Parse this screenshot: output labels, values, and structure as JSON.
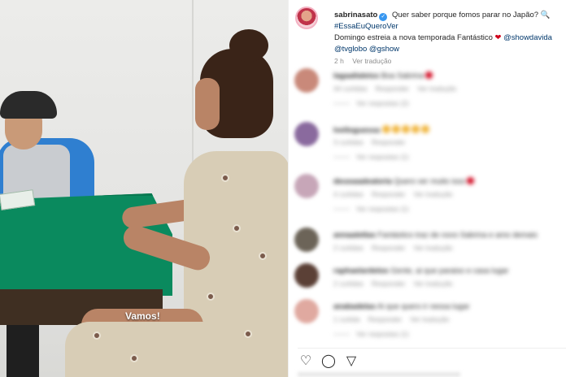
{
  "video": {
    "caption": "Vamos!"
  },
  "post": {
    "username": "sabrinasato",
    "verified_symbol": "✓",
    "text_part1": "Quer saber porque fomos parar no Japão?",
    "text_emoji": "🔍",
    "hashtag": "#EssaEuQueroVer",
    "text_line3": "Domingo estreia a nova temporada Fantástico",
    "heart_symbol": "❤",
    "mention_show": "@showdavida",
    "mention_tvglobo": "@tvglobo",
    "mention_gshow": "@gshow",
    "time": "2 h",
    "translate": "Ver tradução"
  },
  "comments": [
    {
      "user": "lagaallaleiss",
      "text": "Boa Sabrina",
      "likes": "44 curtidas",
      "reply": "Responder",
      "translate": "Ver tradução",
      "replies": "Ver respostas (2)",
      "avatar_color": "#c9897a"
    },
    {
      "user": "lvelloguessa",
      "text": "",
      "likes": "3 curtidas",
      "reply": "Responder",
      "translate": "",
      "replies": "Ver respostas (1)",
      "avatar_color": "#8a6a9e"
    },
    {
      "user": "deusaaaleatoria",
      "text": "Quero ver muito isso",
      "likes": "4 curtidas",
      "reply": "Responder",
      "translate": "Ver tradução",
      "replies": "Ver respostas (1)",
      "avatar_color": "#c7a6b8"
    },
    {
      "user": "annaaletlas",
      "text": "Fantástico traz de novo Sabrina e amo demais",
      "likes": "2 curtidas",
      "reply": "Responder",
      "translate": "Ver tradução",
      "replies": "",
      "avatar_color": "#6c6458"
    },
    {
      "user": "raphaelardelos",
      "text": "Gente, ai que paraiso e casa lugar",
      "likes": "2 curtidas",
      "reply": "Responder",
      "translate": "Ver tradução",
      "replies": "",
      "avatar_color": "#5b4036"
    },
    {
      "user": "anabadelas",
      "text": "Ai que quero ir nessa lugar",
      "likes": "1 curtida",
      "reply": "Responder",
      "translate": "Ver tradução",
      "replies": "Ver respostas (1)",
      "avatar_color": "#e0a9a0"
    }
  ],
  "actions": {
    "like_icon": "heart-icon",
    "comment_icon": "comment-icon",
    "share_icon": "share-icon",
    "like_glyph": "♡",
    "comment_glyph": "◯",
    "share_glyph": "▽"
  }
}
